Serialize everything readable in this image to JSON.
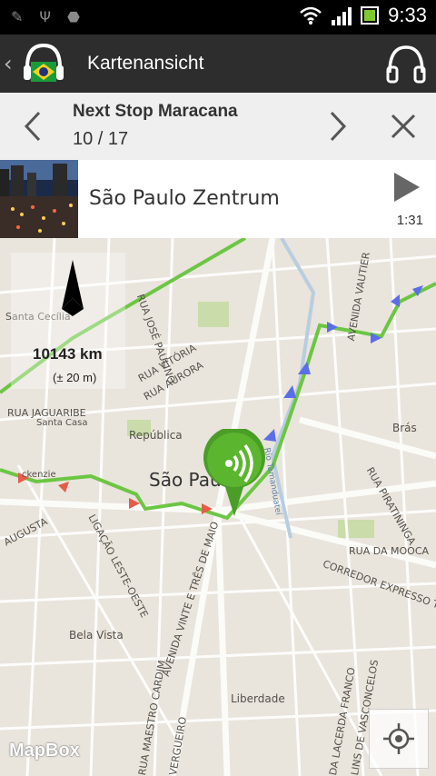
{
  "status_bar": {
    "time": "9:33",
    "icons": [
      "usb-debug-icon",
      "usb-icon",
      "android-icon",
      "wifi-icon",
      "signal-icon",
      "battery-icon"
    ]
  },
  "action_bar": {
    "title": "Kartenansicht",
    "icons": [
      "back-chevron-icon",
      "brazil-flag-headphones-logo",
      "headphones-icon"
    ]
  },
  "stop_bar": {
    "title": "Next Stop Maracana",
    "count": "10 / 17"
  },
  "track": {
    "title": "São Paulo Zentrum",
    "duration": "1:31"
  },
  "map": {
    "city": "São Paulo",
    "distance": "10143 km",
    "accuracy": "(± 20 m)",
    "attribution": "MapBox",
    "labels": {
      "santa_cecilia": "Santa Cecília",
      "republica": "República",
      "bras": "Brás",
      "bela_vista": "Bela Vista",
      "liberdade": "Liberdade",
      "santa_casa": "Santa Casa",
      "rua_jaguaribe": "RUA JAGUARIBE",
      "rua_vitoria": "RUA VITÓRIA",
      "rua_aurora": "RUA AURORA",
      "rua_jose_paulino": "RUA JOSÉ PAULINO",
      "avenida_vautier": "AVENIDA VAUTIER",
      "rua_piratininga": "RUA PIRATININGA",
      "rua_da_mooca": "RUA DA MOOCA",
      "corredor": "CORREDOR EXPRESSO TIRADENTES",
      "augusta": "AUGUSTA",
      "ligacao": "LIGAÇÃO LESTE-OESTE",
      "av_vinte_tres": "AVENIDA VINTE E TRÊS DE MAIO",
      "rua_maestro": "RUA MAESTRO CARDIM",
      "vergueiro": "VERGUEIRO",
      "av_lacerda": "DA LACERDA FRANCO",
      "lins_vasconcelos": "LINS DE VASCONCELOS",
      "rio_tamanduatei": "Rio Tamanduateí",
      "ackenzie": "ckenzie"
    },
    "colors": {
      "route": "#6cc644",
      "arrow_blue": "#5b6ee8",
      "arrow_red": "#e35d4a",
      "marker": "#4a9d26"
    }
  }
}
